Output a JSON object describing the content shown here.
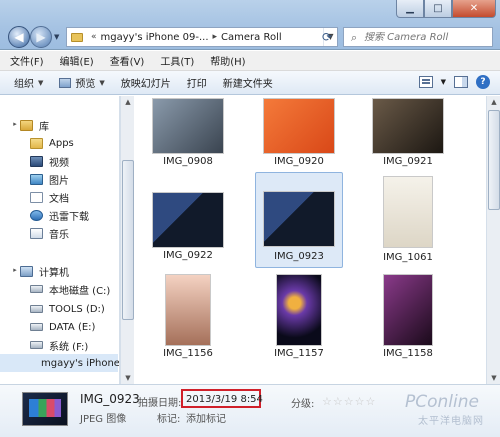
{
  "window": {
    "breadcrumb_prefix": "«",
    "breadcrumb": [
      "mgayy's iPhone 09-...",
      "Camera Roll"
    ],
    "search_placeholder": "搜索 Camera Roll",
    "close_glyph": "✕",
    "min_glyph": "▁",
    "max_glyph": "□"
  },
  "menubar": [
    "文件(F)",
    "编辑(E)",
    "查看(V)",
    "工具(T)",
    "帮助(H)"
  ],
  "commandbar": {
    "organize": "组织",
    "preview": "预览",
    "slideshow": "放映幻灯片",
    "print": "打印",
    "new_folder": "新建文件夹"
  },
  "navigation": {
    "library": "库",
    "apps": "Apps",
    "videos": "视频",
    "pictures": "图片",
    "documents": "文档",
    "thunder": "迅雷下载",
    "music": "音乐",
    "computer": "计算机",
    "drive_c": "本地磁盘 (C:)",
    "drive_d": "TOOLS (D:)",
    "drive_e": "DATA (E:)",
    "drive_f": "系统 (F:)",
    "iphone": "mgayy's iPhone"
  },
  "files": [
    {
      "name": "IMG_0908",
      "colors": [
        "#6a7d8f",
        "#2c3440"
      ]
    },
    {
      "name": "IMG_0920",
      "colors": [
        "#f06a2a",
        "#d9481a"
      ]
    },
    {
      "name": "IMG_0921",
      "colors": [
        "#5a4a3a",
        "#201a14"
      ]
    },
    {
      "name": "IMG_0922",
      "colors": [
        "#2a3a5a",
        "#0d1424"
      ]
    },
    {
      "name": "IMG_0923",
      "colors": [
        "#2a3a5a",
        "#0d1424"
      ]
    },
    {
      "name": "IMG_1061",
      "colors": [
        "#f4f1ea",
        "#dcd6c8"
      ]
    },
    {
      "name": "IMG_1156",
      "colors": [
        "#f2c9b8",
        "#a8745c"
      ]
    },
    {
      "name": "IMG_1157",
      "colors": [
        "#3a2a6a",
        "#0a0a1a"
      ]
    },
    {
      "name": "IMG_1158",
      "colors": [
        "#6a2a6a",
        "#1a0a1a"
      ]
    }
  ],
  "details": {
    "name": "IMG_0923",
    "type": "JPEG 图像",
    "date_label": "拍摄日期:",
    "date_value": "2013/3/19 8:54",
    "tags_label": "标记:",
    "tags_value": "添加标记",
    "rating_label": "分级:",
    "rating_stars": "☆☆☆☆☆",
    "rating_value": 0
  },
  "watermark": {
    "brand": "PConline",
    "sub": "太平洋电脑网"
  }
}
